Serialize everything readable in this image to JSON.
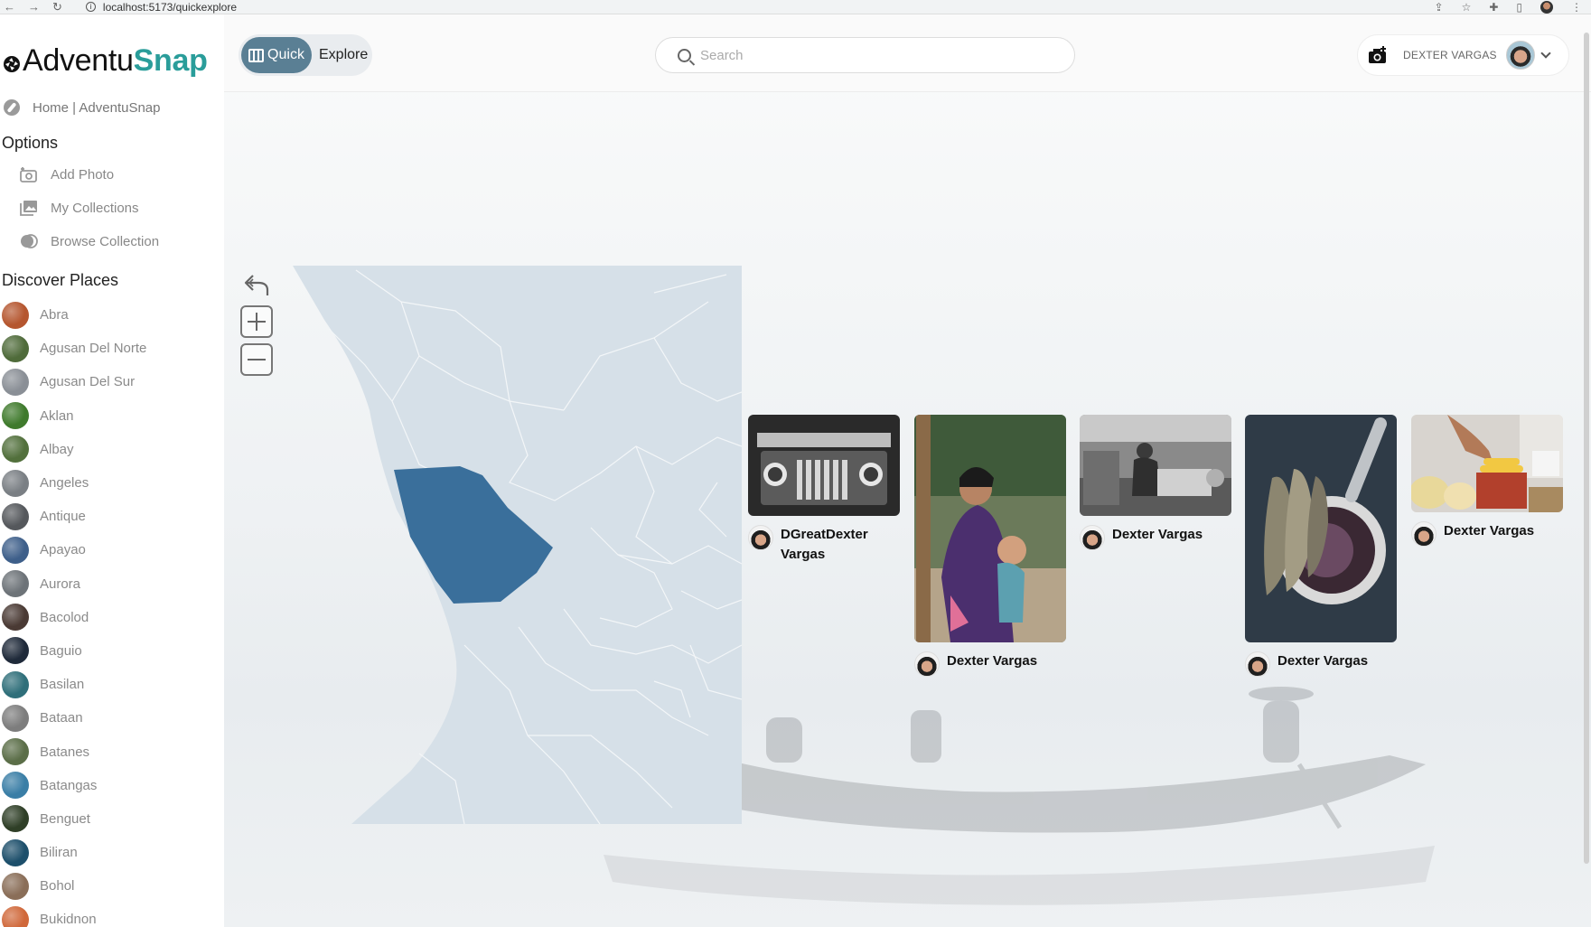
{
  "browser": {
    "url": "localhost:5173/quickexplore",
    "back": "←",
    "forward": "→",
    "reload": "↻",
    "info": "i",
    "share": "⇪",
    "star": "☆",
    "extensions": "✚",
    "sidebar": "▯",
    "menu": "⋮"
  },
  "logo": {
    "part1": "Adventu",
    "part2": "Snap"
  },
  "sidebar": {
    "home_link": "Home | AdventuSnap",
    "options_title": "Options",
    "options": [
      {
        "label": "Add Photo",
        "icon": "add-photo-icon"
      },
      {
        "label": "My Collections",
        "icon": "collections-icon"
      },
      {
        "label": "Browse Collection",
        "icon": "browse-icon"
      }
    ],
    "discover_title": "Discover Places",
    "places": [
      {
        "label": "Abra",
        "color": "#b5562f"
      },
      {
        "label": "Agusan Del Norte",
        "color": "#4f6b3a"
      },
      {
        "label": "Agusan Del Sur",
        "color": "#8a8f96"
      },
      {
        "label": "Aklan",
        "color": "#3f7a2c"
      },
      {
        "label": "Albay",
        "color": "#52703c"
      },
      {
        "label": "Angeles",
        "color": "#7a7f84"
      },
      {
        "label": "Antique",
        "color": "#55585c"
      },
      {
        "label": "Apayao",
        "color": "#3e5f8a"
      },
      {
        "label": "Aurora",
        "color": "#6d7378"
      },
      {
        "label": "Bacolod",
        "color": "#4a3a34"
      },
      {
        "label": "Baguio",
        "color": "#1f2a3a"
      },
      {
        "label": "Basilan",
        "color": "#2f6f7a"
      },
      {
        "label": "Bataan",
        "color": "#7d7d7d"
      },
      {
        "label": "Batanes",
        "color": "#5b6e48"
      },
      {
        "label": "Batangas",
        "color": "#3a7ea6"
      },
      {
        "label": "Benguet",
        "color": "#2f3f27"
      },
      {
        "label": "Biliran",
        "color": "#1d4f6b"
      },
      {
        "label": "Bohol",
        "color": "#8a6e58"
      },
      {
        "label": "Bukidnon",
        "color": "#d0683a"
      }
    ]
  },
  "topbar": {
    "quick_label": "Quick",
    "explore_label": "Explore",
    "search_placeholder": "Search",
    "user_name": "DEXTER VARGAS"
  },
  "map": {
    "selected_fill": "#3a6f9b",
    "region_fill": "#d6e0e8",
    "border_color": "#f3f6f8"
  },
  "photos": [
    {
      "author_line1": "DGreatDexter",
      "author_line2": "Vargas",
      "subject": "vintage jeep grille"
    },
    {
      "author_line1": "Dexter Vargas",
      "subject": "mother and child"
    },
    {
      "author_line1": "Dexter Vargas",
      "subject": "street vendor cart"
    },
    {
      "author_line1": "Dexter Vargas",
      "subject": "dried fish and vinegar"
    },
    {
      "author_line1": "Dexter Vargas",
      "subject": "fruit stall"
    }
  ]
}
